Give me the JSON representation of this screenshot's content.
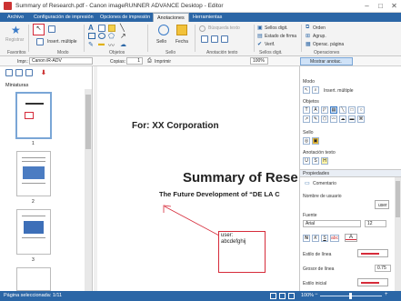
{
  "window": {
    "title": "Summary of Research.pdf - Canon imageRUNNER ADVANCE Desktop - Editor",
    "controls": [
      "–",
      "□",
      "✕"
    ]
  },
  "menu_tabs": [
    "Archivo",
    "Configuración de impresión",
    "Opciones de impresión",
    "Anotaciones",
    "Herramientas"
  ],
  "active_tab": "Anotaciones",
  "ribbon": {
    "groups": {
      "favoritos": "Favoritos",
      "modo": "Modo",
      "objetos": "Objetos",
      "sello": "Sello",
      "anotacion_texto": "Anotación texto",
      "sellos_digit": "Sellos digit.",
      "operaciones": "Operaciones"
    },
    "registrar": "Registrar",
    "insert_multiple": "Insert. múltiple",
    "sello_btn": "Sello",
    "fecha_btn": "Fecha",
    "busqueda_texto": "Búsqueda texto",
    "sellos_digit_btn": "Sellos digit.",
    "estado_firma": "Estado de firma",
    "verif": "Verif.",
    "orden": "Orden",
    "agrup": "Agrup.",
    "operac_pagina": "Operac. página"
  },
  "toolbar": {
    "impr_label": "Impr.:",
    "printer": "Canon iR-ADV",
    "copias_label": "Copias:",
    "copias_value": "1",
    "imprimir": "Imprimir",
    "zoom_value": "100%",
    "mostrar_anotac": "Mostrar anotac."
  },
  "left_pane": {
    "title": "Miniaturas",
    "pages": [
      "1",
      "2",
      "3"
    ]
  },
  "document": {
    "for_line": "For: XX Corporation",
    "title": "Summary of Rese",
    "subtitle": "The Future Development of “DE LA C",
    "annotation_text": "user:\nabcdefghij"
  },
  "right_pane": {
    "modo": "Modo",
    "insert_multiple": "Insert. múltiple",
    "objetos": "Objetos",
    "sello": "Sello",
    "anotacion_texto": "Anotación texto",
    "propiedades": "Propiedades",
    "comentario": "Comentario",
    "nombre_usuario": "Nombre de usuario",
    "user": "user",
    "fuente": "Fuente",
    "font_name": "Arial",
    "font_size": "12",
    "estilo_linea": "Estilo de línea",
    "grosor_linea": "Grosor de línea",
    "grosor_value": "0.75",
    "estilo_inicial": "Estilo inicial"
  },
  "status": {
    "page_info": "Página seleccionada: 1/11",
    "zoom": "100%"
  },
  "colors": {
    "accent": "#2b66a6",
    "annotation": "#d62b3a"
  }
}
